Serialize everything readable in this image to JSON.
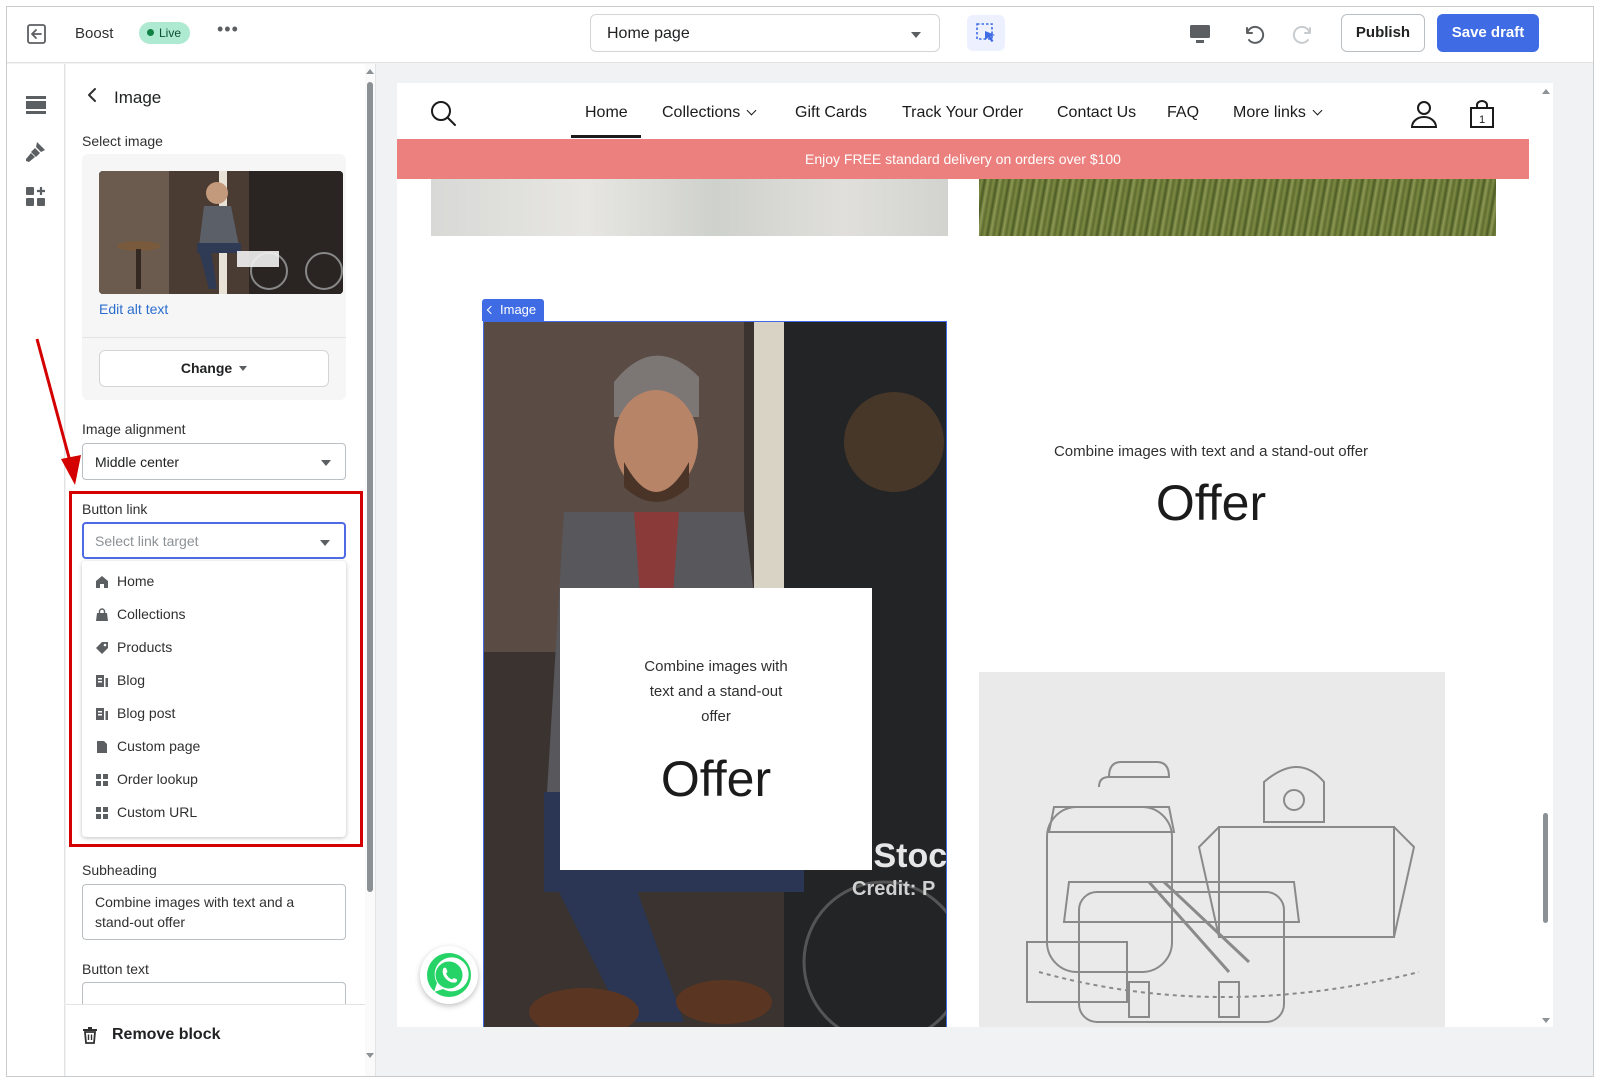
{
  "topbar": {
    "store_name": "Boost",
    "status_badge": "Live",
    "more_label": "•••",
    "page_selector": "Home page",
    "publish_label": "Publish",
    "save_label": "Save draft"
  },
  "panel": {
    "title": "Image",
    "select_image_label": "Select image",
    "edit_alt_text": "Edit alt text",
    "change_label": "Change",
    "image_alignment_label": "Image alignment",
    "image_alignment_value": "Middle center",
    "button_link_label": "Button link",
    "button_link_placeholder": "Select link target",
    "link_options": [
      "Home",
      "Collections",
      "Products",
      "Blog",
      "Blog post",
      "Custom page",
      "Order lookup",
      "Custom URL"
    ],
    "subheading_label": "Subheading",
    "subheading_value": "Combine images with text and a stand-out offer",
    "button_text_label": "Button text",
    "remove_block_label": "Remove block"
  },
  "preview": {
    "nav": {
      "items": [
        "Home",
        "Collections",
        "Gift Cards",
        "Track Your Order",
        "Contact Us",
        "FAQ",
        "More links"
      ],
      "active": "Home",
      "cart_count": "1"
    },
    "announcement": "Enjoy FREE standard delivery on orders over $100",
    "image_tag": "Image",
    "hero_overlay": {
      "subheading": "Combine images with text and a stand-out offer",
      "heading": "Offer"
    },
    "right_block": {
      "subheading": "Combine images with text and a stand-out offer",
      "heading": "Offer"
    },
    "watermark_text_1": "iStock",
    "watermark_text_2": "Credit: P"
  },
  "colors": {
    "accent": "#3f6ce5",
    "announcement_bg": "#eb807e",
    "live_badge_bg": "#aee9d1",
    "annotation_red": "#d40000"
  }
}
